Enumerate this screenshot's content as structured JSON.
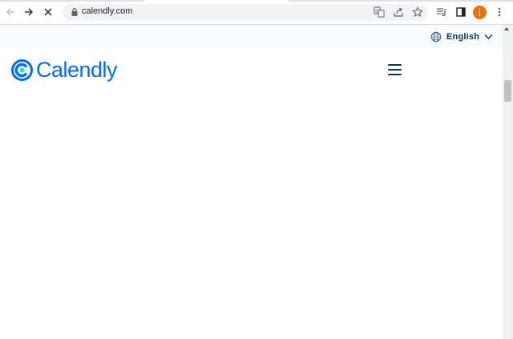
{
  "browser": {
    "url": "calendly.com",
    "avatar_letter": "j",
    "avatar_color": "#e8710a",
    "icons": [
      "back-icon",
      "forward-icon",
      "stop-icon",
      "lock-icon",
      "translate-icon",
      "share-icon",
      "bookmark-star-icon",
      "reading-list-icon",
      "side-panel-icon",
      "menu-kebab-icon"
    ]
  },
  "page": {
    "language_label": "English",
    "logo_text": "Calendly",
    "brand_color": "#006bff",
    "text_color": "#0b3558"
  }
}
